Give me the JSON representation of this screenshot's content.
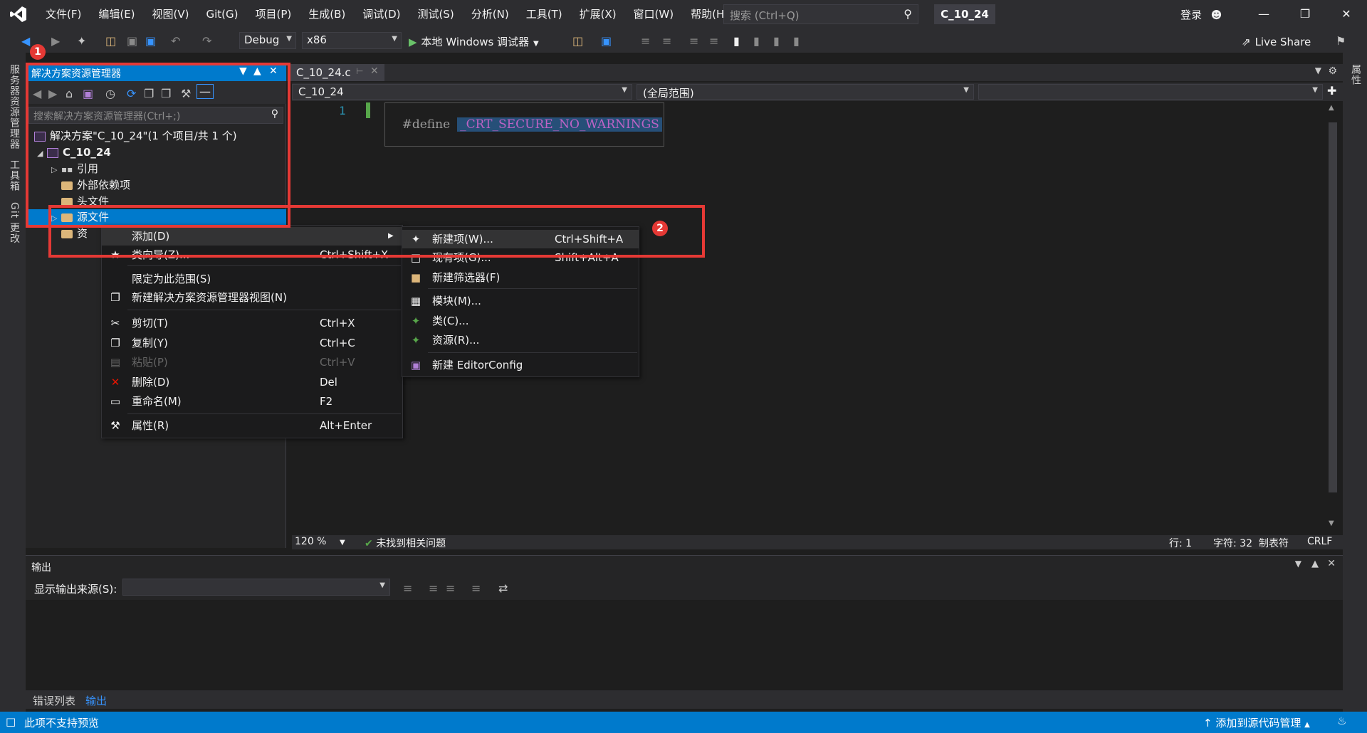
{
  "titlebar": {
    "menus": [
      "文件(F)",
      "编辑(E)",
      "视图(V)",
      "Git(G)",
      "项目(P)",
      "生成(B)",
      "调试(D)",
      "测试(S)",
      "分析(N)",
      "工具(T)",
      "扩展(X)",
      "窗口(W)",
      "帮助(H)"
    ],
    "search_placeholder": "搜索 (Ctrl+Q)",
    "solution_name": "C_10_24",
    "login": "登录"
  },
  "toolbar": {
    "config": "Debug",
    "platform": "x86",
    "run_label": "本地 Windows 调试器",
    "live_share": "Live Share"
  },
  "left_strip": {
    "tabs": [
      "服务器资源管理器",
      "工具箱",
      "Git 更改"
    ]
  },
  "right_strip": {
    "tabs": [
      "属性"
    ]
  },
  "solution_explorer": {
    "title": "解决方案资源管理器",
    "search_placeholder": "搜索解决方案资源管理器(Ctrl+;)",
    "solution_label": "解决方案\"C_10_24\"(1 个项目/共 1 个)",
    "project": "C_10_24",
    "items": [
      {
        "label": "引用"
      },
      {
        "label": "外部依赖项"
      },
      {
        "label": "头文件"
      },
      {
        "label": "源文件"
      },
      {
        "label": "资"
      }
    ]
  },
  "editor": {
    "tab_label": "C_10_24.c",
    "nav_project": "C_10_24",
    "nav_scope": "(全局范围)",
    "line_number": "1",
    "code_keyword": "#define",
    "code_macro": "_CRT_SECURE_NO_WARNINGS",
    "zoom": "120 %",
    "issues": "未找到相关问题",
    "line": "行: 1",
    "char": "字符: 32",
    "tab_mode": "制表符",
    "eol": "CRLF"
  },
  "context_menu": {
    "items": [
      {
        "label": "添加(D)",
        "shortcut": "",
        "icon": "none"
      },
      {
        "label": "类向导(Z)...",
        "shortcut": "Ctrl+Shift+X",
        "icon": "class-wizard-icon"
      },
      {
        "label": "限定为此范围(S)",
        "shortcut": "",
        "icon": "none"
      },
      {
        "label": "新建解决方案资源管理器视图(N)",
        "shortcut": "",
        "icon": "new-view-icon"
      },
      {
        "label": "剪切(T)",
        "shortcut": "Ctrl+X",
        "icon": "scissors-icon"
      },
      {
        "label": "复制(Y)",
        "shortcut": "Ctrl+C",
        "icon": "copy-icon"
      },
      {
        "label": "粘贴(P)",
        "shortcut": "Ctrl+V",
        "icon": "paste-icon"
      },
      {
        "label": "删除(D)",
        "shortcut": "Del",
        "icon": "delete-icon"
      },
      {
        "label": "重命名(M)",
        "shortcut": "F2",
        "icon": "rename-icon"
      },
      {
        "label": "属性(R)",
        "shortcut": "Alt+Enter",
        "icon": "wrench-icon"
      }
    ]
  },
  "add_submenu": {
    "items": [
      {
        "label": "新建项(W)...",
        "shortcut": "Ctrl+Shift+A",
        "icon": "new-item-icon"
      },
      {
        "label": "现有项(G)...",
        "shortcut": "Shift+Alt+A",
        "icon": "existing-item-icon"
      },
      {
        "label": "新建筛选器(F)",
        "shortcut": "",
        "icon": "new-filter-icon"
      },
      {
        "label": "模块(M)...",
        "shortcut": "",
        "icon": "module-icon"
      },
      {
        "label": "类(C)...",
        "shortcut": "",
        "icon": "class-icon"
      },
      {
        "label": "资源(R)...",
        "shortcut": "",
        "icon": "resource-icon"
      },
      {
        "label": "新建 EditorConfig",
        "shortcut": "",
        "icon": "editorconfig-icon"
      }
    ]
  },
  "output_panel": {
    "title": "输出",
    "source_label": "显示输出来源(S):"
  },
  "bottom_tabs": [
    "错误列表",
    "输出"
  ],
  "statusbar": {
    "left": "此项不支持预览",
    "right": "添加到源代码管理"
  },
  "annotations": {
    "marker1": "1",
    "marker2": "2",
    "color": "#e53935"
  }
}
